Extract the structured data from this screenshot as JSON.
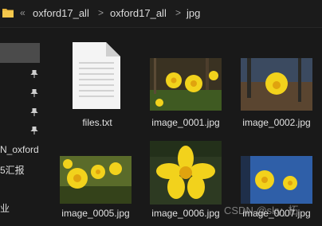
{
  "breadcrumb": {
    "items": [
      "oxford17_all",
      "oxford17_all",
      "jpg"
    ],
    "separator": ">"
  },
  "sidebar": {
    "labels": [
      "N_oxford",
      "5汇报",
      "业"
    ]
  },
  "files": [
    {
      "name": "files.txt",
      "type": "text-file"
    },
    {
      "name": "image_0001.jpg",
      "type": "image"
    },
    {
      "name": "image_0002.jpg",
      "type": "image"
    },
    {
      "name": "image_0005.jpg",
      "type": "image"
    },
    {
      "name": "image_0006.jpg",
      "type": "image"
    },
    {
      "name": "image_0007.jpg",
      "type": "image"
    }
  ],
  "watermark": "CSDN @sky_柘",
  "colors": {
    "background": "#191919",
    "selection": "#4b4b4b",
    "folder": "#e8b43a",
    "petal": "#f2d21c"
  }
}
